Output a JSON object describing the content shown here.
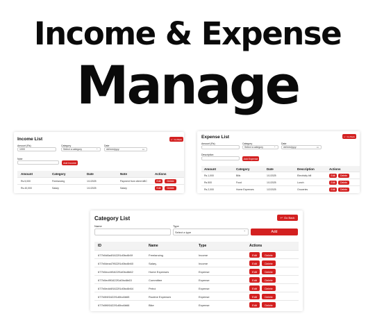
{
  "headline": {
    "line1": "Income & Expense",
    "line2": "Manage"
  },
  "income": {
    "title": "Income List",
    "back_label": "Go Back",
    "amount_label": "Amount (Rs)",
    "amount_value": "1000",
    "category_label": "Category",
    "category_value": "Select a category",
    "date_label": "Date",
    "date_value": "dd/mm/yyyy",
    "note_label": "Note",
    "note_value": "",
    "add_label": "Add Income",
    "columns": [
      "Amount",
      "Category",
      "Date",
      "Note",
      "Actions"
    ],
    "rows": [
      {
        "amount": "Rs.5,000",
        "category": "Freelancing",
        "date": "1/1/2025",
        "note": "Payment from client ABC"
      },
      {
        "amount": "Rs.40,000",
        "category": "Salary",
        "date": "1/1/2025",
        "note": "Salary"
      }
    ],
    "edit_label": "Edit",
    "delete_label": "Delete"
  },
  "expense": {
    "title": "Expense List",
    "back_label": "Go Back",
    "amount_label": "Amount (Rs)",
    "amount_value": "",
    "category_label": "Category",
    "category_value": "Select a category",
    "date_label": "Date",
    "date_value": "dd/mm/yyyy",
    "description_label": "Description",
    "description_value": "",
    "add_label": "Add Expense",
    "columns": [
      "Amount",
      "Category",
      "Date",
      "Description",
      "Actions"
    ],
    "rows": [
      {
        "amount": "Rs.1,000",
        "category": "Bills",
        "date": "1/1/2025",
        "description": "Electricity bill"
      },
      {
        "amount": "Rs.500",
        "category": "Food",
        "date": "1/1/2025",
        "description": "Lunch"
      },
      {
        "amount": "Rs.2,000",
        "category": "Home Expenses",
        "date": "1/2/2025",
        "description": "Groceries"
      }
    ],
    "edit_label": "Edit",
    "delete_label": "Delete"
  },
  "category": {
    "title": "Category List",
    "back_label": "Go Back",
    "name_label": "Name",
    "name_value": "",
    "type_label": "Type",
    "type_value": "Select a type",
    "add_label": "Add",
    "columns": [
      "ID",
      "Name",
      "Type",
      "Actions"
    ],
    "rows": [
      {
        "id": "677b0d8a4f1622f1d0bc6b5f",
        "name": "Freelancing",
        "type": "Income"
      },
      {
        "id": "677b0dea47f822f1d0bc6b60",
        "name": "Salary",
        "type": "Income"
      },
      {
        "id": "677b0ecd4f1622f1d0bc6b62",
        "name": "Home Expenses",
        "type": "Expense"
      },
      {
        "id": "677b0ed9f1622f1d0bc6b63",
        "name": "Committee",
        "type": "Expense"
      },
      {
        "id": "677b0edd4f1622f1d0bc6b64",
        "name": "Petrol",
        "type": "Expense"
      },
      {
        "id": "677b0f4f1622f1d0bc6b65",
        "name": "Routine Expenses",
        "type": "Expense"
      },
      {
        "id": "677b0f6f1622f1d0bc6b66",
        "name": "Bike",
        "type": "Expense"
      }
    ],
    "edit_label": "Edit",
    "delete_label": "Delete"
  }
}
